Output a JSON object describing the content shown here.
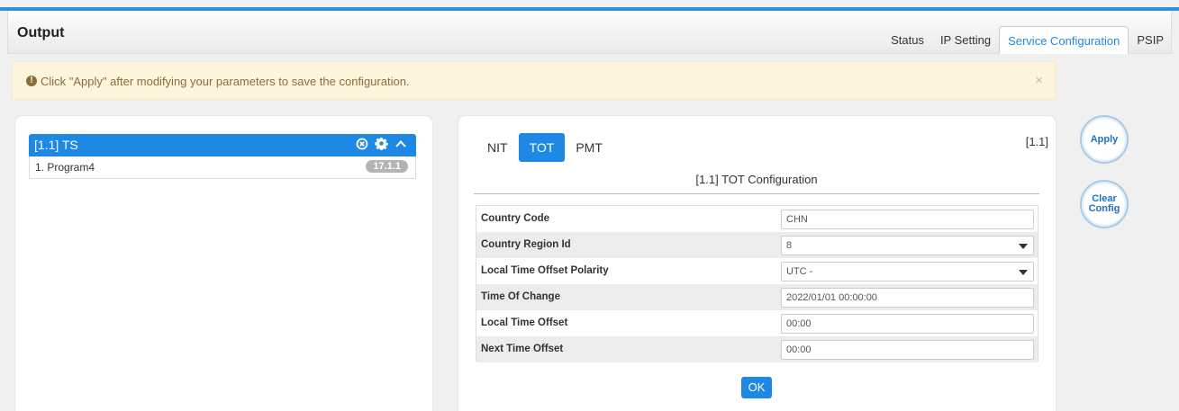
{
  "header": {
    "title": "Output"
  },
  "tabs": [
    {
      "label": "Status",
      "active": false
    },
    {
      "label": "IP Setting",
      "active": false
    },
    {
      "label": "Service Configuration",
      "active": true
    },
    {
      "label": "PSIP",
      "active": false
    }
  ],
  "alert": {
    "icon": "exclamation-circle-icon",
    "text": "Click \"Apply\" after modifying your parameters to save the configuration.",
    "close": "×"
  },
  "ts_panel": {
    "title": "[1.1] TS",
    "icons": [
      "close-circle-icon",
      "gear-icon",
      "chevron-up-icon"
    ],
    "programs": [
      {
        "name": "1. Program4",
        "badge": "17.1.1"
      }
    ]
  },
  "config_panel": {
    "subtabs": [
      {
        "label": "NIT",
        "active": false
      },
      {
        "label": "TOT",
        "active": true
      },
      {
        "label": "PMT",
        "active": false
      }
    ],
    "tag": "[1.1]",
    "title": "[1.1] TOT Configuration",
    "fields": [
      {
        "label": "Country Code",
        "value": "CHN",
        "type": "text"
      },
      {
        "label": "Country Region Id",
        "value": "8",
        "type": "select"
      },
      {
        "label": "Local Time Offset Polarity",
        "value": "UTC -",
        "type": "select"
      },
      {
        "label": "Time Of Change",
        "value": "2022/01/01 00:00:00",
        "type": "text"
      },
      {
        "label": "Local Time Offset",
        "value": "00:00",
        "type": "text"
      },
      {
        "label": "Next Time Offset",
        "value": "00:00",
        "type": "text"
      }
    ],
    "ok_label": "OK"
  },
  "actions": {
    "apply_label": "Apply",
    "clear_label_line1": "Clear",
    "clear_label_line2": "Config"
  },
  "colors": {
    "accent": "#1e88e5",
    "alert_bg": "#fdf6dc",
    "alert_text": "#8a6d3b"
  }
}
